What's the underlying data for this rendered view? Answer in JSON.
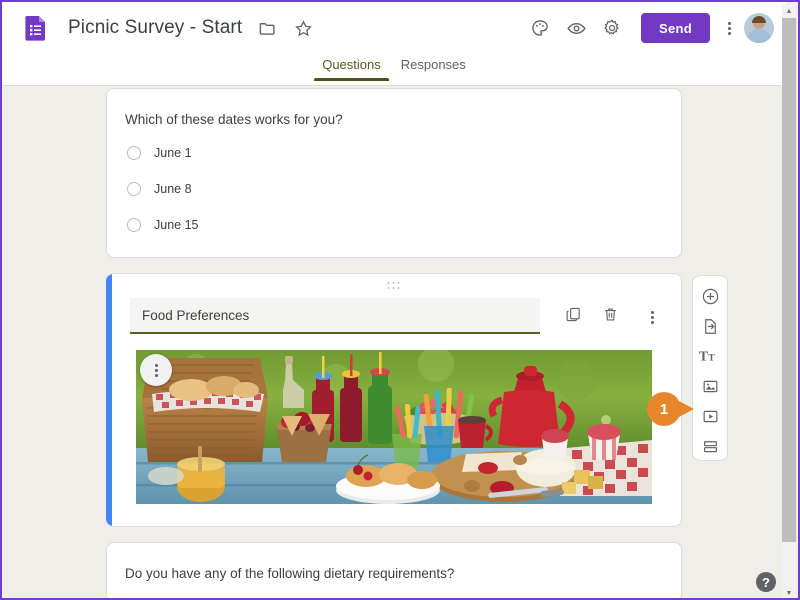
{
  "window": {
    "accent_border_color": "#6b3fd4",
    "canvas_bg_color": "#efeee8"
  },
  "topbar": {
    "logo_icon": "google-forms-icon",
    "doc_title": "Picnic Survey - Start",
    "folder_icon": "folder-icon",
    "star_icon": "star-icon",
    "theme_icon": "palette-icon",
    "preview_icon": "eye-icon",
    "settings_icon": "gear-icon",
    "send_label": "Send",
    "send_color": "#7239c4",
    "more_icon": "more-vertical-icon",
    "avatar_icon": "user-avatar"
  },
  "tabs": [
    {
      "label": "Questions",
      "active": true
    },
    {
      "label": "Responses",
      "active": false
    }
  ],
  "cards": {
    "dates": {
      "question": "Which of these dates works for you?",
      "options": [
        {
          "label": "June 1"
        },
        {
          "label": "June 8"
        },
        {
          "label": "June 15"
        }
      ]
    },
    "food": {
      "drag_handle_icon": "drag-dots-icon",
      "title_value": "Food Preferences",
      "title_underline_color": "#5c6122",
      "selected_accent_color": "#4285f4",
      "duplicate_icon": "duplicate-icon",
      "delete_icon": "trash-icon",
      "more_icon": "more-vertical-icon",
      "image_menu_icon": "more-vertical-icon",
      "image_alt": "picnic-photo"
    },
    "diet": {
      "question": "Do you have any of the following dietary requirements?"
    }
  },
  "side_toolbar": {
    "items": [
      {
        "icon": "add-question-icon",
        "name": "add-question"
      },
      {
        "icon": "import-questions-icon",
        "name": "import-questions"
      },
      {
        "icon": "add-title-icon",
        "name": "add-title-and-description"
      },
      {
        "icon": "add-image-icon",
        "name": "add-image"
      },
      {
        "icon": "add-video-icon",
        "name": "add-video"
      },
      {
        "icon": "add-section-icon",
        "name": "add-section"
      }
    ]
  },
  "callout": {
    "number": "1",
    "color": "#e8862c"
  },
  "help": {
    "label": "?"
  },
  "scrollbar": {
    "up_arrow": "▲",
    "down_arrow": "▼"
  }
}
